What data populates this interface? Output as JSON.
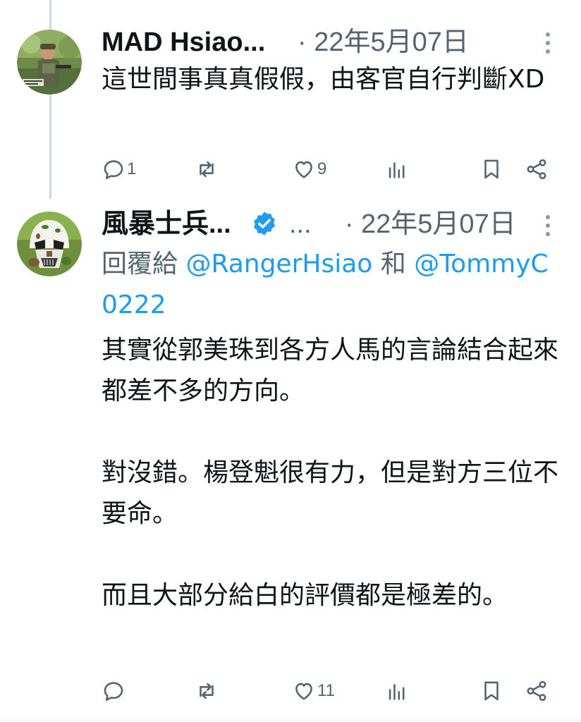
{
  "tweets": [
    {
      "display_name": "MAD Hsiao...",
      "separator": "·",
      "date": "22年5月07日",
      "text": "這世間事真真假假，由客官自行判斷XD",
      "actions": {
        "reply_count": "1",
        "retweet_count": "",
        "like_count": "9"
      },
      "avatar_icon": "soldier-photo-avatar"
    },
    {
      "display_name": "風暴士兵...",
      "verified": true,
      "ellipsis": "...",
      "separator": "·",
      "date": "22年5月07日",
      "reply_to_prefix": "回覆給",
      "reply_to_user1": "@RangerHsiao",
      "reply_to_conj": "和",
      "reply_to_user2": "@TommyC0222",
      "text": "其實從郭美珠到各方人馬的言論結合起來都差不多的方向。\n\n對沒錯。楊登魁很有力，但是對方三位不要命。\n\n而且大部分給白的評價都是極差的。",
      "actions": {
        "reply_count": "",
        "retweet_count": "",
        "like_count": "11"
      },
      "avatar_icon": "stormtrooper-helmet-avatar"
    }
  ],
  "colors": {
    "text_primary": "#0f1419",
    "text_secondary": "#536471",
    "link": "#1d9bf0",
    "verified": "#1d9bf0",
    "thread_line": "#cfd9de"
  }
}
